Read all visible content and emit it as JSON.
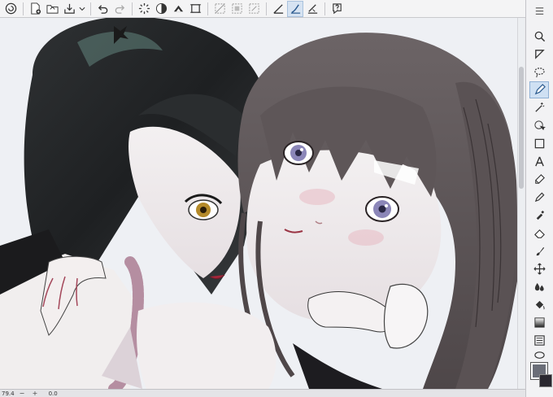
{
  "toolbar": {
    "buttons": [
      {
        "icon": "app-menu-icon"
      },
      {
        "icon": "new-file-icon"
      },
      {
        "icon": "open-folder-icon"
      },
      {
        "icon": "save-icon"
      },
      {
        "icon": "undo-icon"
      },
      {
        "icon": "redo-icon"
      },
      {
        "icon": "loading-spinner-icon"
      },
      {
        "icon": "fill-bucket-icon"
      },
      {
        "icon": "transform-icon"
      },
      {
        "icon": "deselect-icon"
      },
      {
        "icon": "invert-selection-icon"
      },
      {
        "icon": "crop-icon"
      },
      {
        "icon": "ruler-icon"
      },
      {
        "icon": "pen-stroke-icon"
      },
      {
        "icon": "stabilizer-icon"
      },
      {
        "icon": "help-icon"
      }
    ]
  },
  "status": {
    "zoom": "79.4",
    "controls": [
      "−",
      "+",
      "0.0"
    ]
  },
  "colors": {
    "main": "#6b6e78",
    "sub": "#2a2830",
    "accent": "#8fb0d4"
  }
}
